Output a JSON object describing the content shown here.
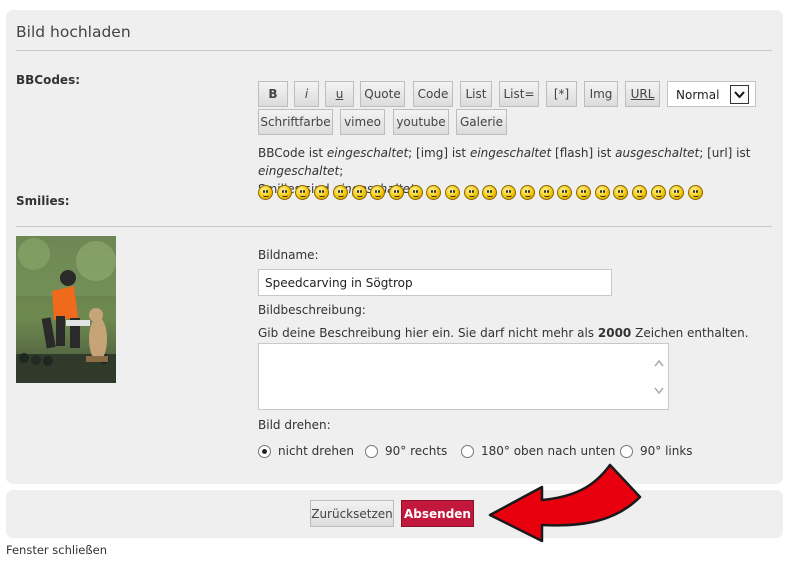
{
  "panel": {
    "title": "Bild hochladen"
  },
  "bbcodes": {
    "label": "BBCodes:",
    "buttons": [
      "B",
      "i",
      "u",
      "Quote",
      "Code",
      "List",
      "List=",
      "[*]",
      "Img",
      "URL"
    ],
    "buttons_row2": [
      "Schriftfarbe",
      "vimeo",
      "youtube",
      "Galerie"
    ],
    "size_select": "Normal"
  },
  "info": {
    "t1": "BBCode ist ",
    "s1": "eingeschaltet",
    "t2": "; [img] ist ",
    "s2": "eingeschaltet",
    "t3": " [flash] ist ",
    "s3": "ausgeschaltet",
    "t4": "; [url] ist ",
    "s4": "eingeschaltet",
    "t5": ";",
    "t6": "Smilies sind ",
    "s6": "eingeschaltet"
  },
  "smilies": {
    "label": "Smilies:",
    "count": 24
  },
  "form": {
    "name_label": "Bildname:",
    "name_value": "Speedcarving in Sögtrop",
    "desc_label": "Bildbeschreibung:",
    "desc_hint_pre": "Gib deine Beschreibung hier ein. Sie darf nicht mehr als ",
    "desc_hint_num": "2000",
    "desc_hint_post": " Zeichen enthalten.",
    "desc_value": "",
    "rotate_label": "Bild drehen:",
    "rotate_options": [
      "nicht drehen",
      "90° rechts",
      "180° oben nach unten",
      "90° links"
    ],
    "rotate_selected": "nicht drehen"
  },
  "actions": {
    "reset": "Zurücksetzen",
    "submit": "Absenden"
  },
  "footer": {
    "close": "Fenster schließen"
  },
  "colors": {
    "submit": "#c2183d",
    "panel": "#efefef",
    "arrow": "#e8000e"
  }
}
